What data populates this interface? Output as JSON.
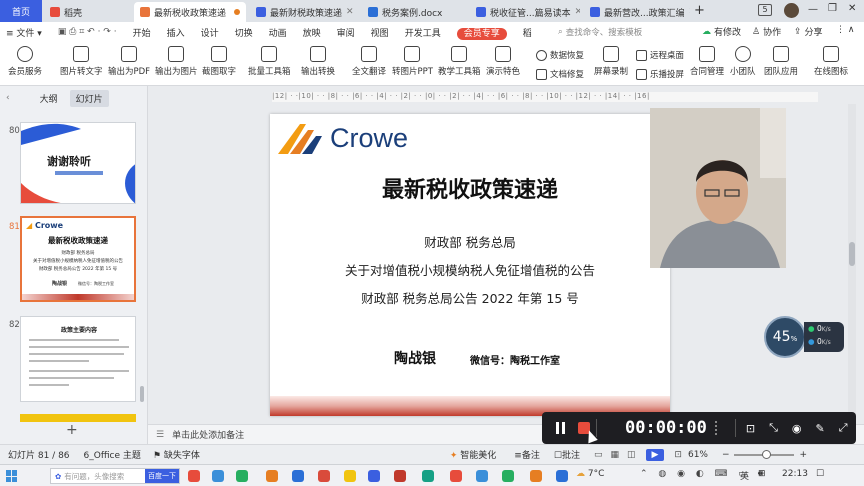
{
  "tabs": {
    "home": "首页",
    "items": [
      {
        "label": "稻壳",
        "color": "#e74c3c"
      },
      {
        "label": "最新税收政策速递",
        "color": "#e8743b",
        "active": true
      },
      {
        "label": "最新财税政策速递",
        "color": "#3b5fe0"
      },
      {
        "label": "税务案例.docx",
        "color": "#2b6fd6"
      },
      {
        "label": "税收征管...篇易读本",
        "color": "#3b5fe0"
      },
      {
        "label": "最新营改...政策汇编",
        "color": "#3b5fe0"
      }
    ],
    "add": "+",
    "badge": "5"
  },
  "menubar": {
    "file": "文件",
    "items": [
      "开始",
      "插入",
      "设计",
      "切换",
      "动画",
      "放映",
      "审阅",
      "视图",
      "开发工具"
    ],
    "vip": "会员专享",
    "more": "稻",
    "search_placeholder": "查找命令、搜索模板",
    "has_changes": "有修改",
    "collab": "协作",
    "share": "分享"
  },
  "toolbar": {
    "items": [
      "会员服务",
      "图片转文字",
      "输出为PDF",
      "输出为图片",
      "截图取字",
      "批量工具箱",
      "输出转换",
      "全文翻译",
      "转图片PPT",
      "教学工具箱",
      "演示特色",
      "屏幕录制",
      "乐播投屏",
      "合同管理",
      "小团队",
      "团队应用",
      "在线图标"
    ],
    "small": [
      "数据恢复",
      "文档修复",
      "远程桌面"
    ]
  },
  "left_panel": {
    "tab_outline": "大纲",
    "tab_slides": "幻灯片",
    "slides": [
      {
        "num": "80",
        "title": "谢谢聆听"
      },
      {
        "num": "81",
        "title": "最新税收政策速递",
        "line1": "财政部 税务总局",
        "line2": "关于对增值税小规模纳税人免征增值税的公告",
        "line3": "财政部 税务总局公告 2022 年第 15 号",
        "author": "陶战银",
        "wechat": "微信号：陶税工作室"
      },
      {
        "num": "82",
        "title": "政策主要内容"
      }
    ],
    "add": "+"
  },
  "ruler": {
    "text": "|12| · ·|10| · · |8| · · |6| · · |4| · · |2| · · |0| · · |2| · · |4| · · |6| · · |8| · · |10| · · |12| · · |14| · · |16|"
  },
  "slide": {
    "logo": "Crowe",
    "title": "最新税收政策速递",
    "line1": "财政部  税务总局",
    "line2": "关于对增值税小规模纳税人免征增值税的公告",
    "line3": "财政部  税务总局公告 2022 年第 15 号",
    "author": "陶战银",
    "wechat": "微信号：陶税工作室"
  },
  "notes": {
    "placeholder": "单击此处添加备注"
  },
  "status": {
    "slide_count": "幻灯片 81 / 86",
    "theme": "6_Office 主题",
    "missing_font": "缺失字体",
    "smart": "智能美化",
    "notes": "备注",
    "comments": "批注",
    "zoom": "61%"
  },
  "recorder": {
    "time": "00:00:00"
  },
  "meter": {
    "percent": "45",
    "unit": "%",
    "up": "0",
    "up_unit": "K/s",
    "down": "0",
    "down_unit": "K/s"
  },
  "taskbar": {
    "search_placeholder": "有问题，头像搜索",
    "search_button": "百度一下",
    "temperature": "7°C",
    "ime": "英",
    "time": "22:13",
    "colors": [
      "#e74c3c",
      "#3b8fd9",
      "#27ae60",
      "#e67e22",
      "#2b6fd6",
      "#d94b3b",
      "#f1c40f",
      "#3b5fe0",
      "#c0392b",
      "#16a085"
    ]
  },
  "colors": {
    "accent": "#3b5fe0",
    "crowe_orange": "#f39c12",
    "crowe_navy": "#1b3f7a",
    "slide_red": "#c0392b",
    "recorder_bg": "#1e1e22"
  }
}
